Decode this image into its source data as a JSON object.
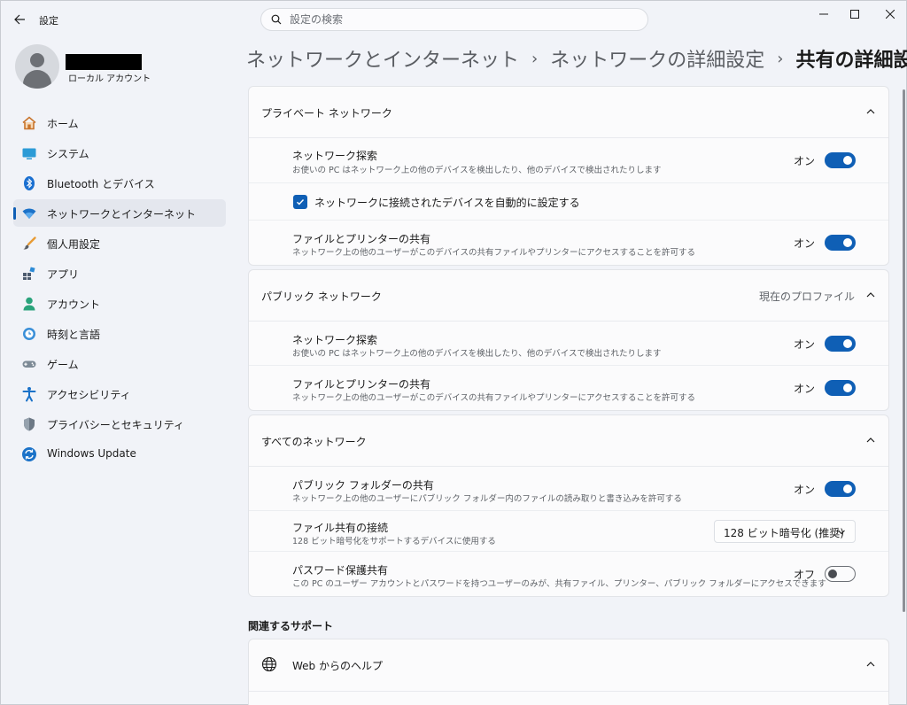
{
  "window": {
    "title": "設定",
    "search_placeholder": "設定の検索"
  },
  "profile": {
    "account_type": "ローカル アカウント"
  },
  "sidebar": {
    "items": [
      {
        "label": "ホーム",
        "icon": "home-icon"
      },
      {
        "label": "システム",
        "icon": "system-icon"
      },
      {
        "label": "Bluetooth とデバイス",
        "icon": "bluetooth-icon"
      },
      {
        "label": "ネットワークとインターネット",
        "icon": "network-icon",
        "selected": true
      },
      {
        "label": "個人用設定",
        "icon": "brush-icon"
      },
      {
        "label": "アプリ",
        "icon": "apps-icon"
      },
      {
        "label": "アカウント",
        "icon": "account-icon"
      },
      {
        "label": "時刻と言語",
        "icon": "time-language-icon"
      },
      {
        "label": "ゲーム",
        "icon": "gamepad-icon"
      },
      {
        "label": "アクセシビリティ",
        "icon": "accessibility-icon"
      },
      {
        "label": "プライバシーとセキュリティ",
        "icon": "shield-icon"
      },
      {
        "label": "Windows Update",
        "icon": "update-icon"
      }
    ]
  },
  "breadcrumb": {
    "level1": "ネットワークとインターネット",
    "level2": "ネットワークの詳細設定",
    "current": "共有の詳細設定",
    "separator": "›"
  },
  "private_network": {
    "title": "プライベート ネットワーク",
    "discovery": {
      "title": "ネットワーク探索",
      "desc": "お使いの PC はネットワーク上の他のデバイスを検出したり、他のデバイスで検出されたりします",
      "state": "オン"
    },
    "auto_setup": {
      "label": "ネットワークに接続されたデバイスを自動的に設定する",
      "checked": true
    },
    "file_printer": {
      "title": "ファイルとプリンターの共有",
      "desc": "ネットワーク上の他のユーザーがこのデバイスの共有ファイルやプリンターにアクセスすることを許可する",
      "state": "オン"
    }
  },
  "public_network": {
    "title": "パブリック ネットワーク",
    "note": "現在のプロファイル",
    "discovery": {
      "title": "ネットワーク探索",
      "desc": "お使いの PC はネットワーク上の他のデバイスを検出したり、他のデバイスで検出されたりします",
      "state": "オン"
    },
    "file_printer": {
      "title": "ファイルとプリンターの共有",
      "desc": "ネットワーク上の他のユーザーがこのデバイスの共有ファイルやプリンターにアクセスすることを許可する",
      "state": "オン"
    }
  },
  "all_networks": {
    "title": "すべてのネットワーク",
    "public_folder": {
      "title": "パブリック フォルダーの共有",
      "desc": "ネットワーク上の他のユーザーにパブリック フォルダー内のファイルの読み取りと書き込みを許可する",
      "state": "オン"
    },
    "file_sharing_conn": {
      "title": "ファイル共有の接続",
      "desc": "128 ビット暗号化をサポートするデバイスに使用する",
      "value": "128 ビット暗号化 (推奨)"
    },
    "password_sharing": {
      "title": "パスワード保護共有",
      "desc": "この PC のユーザー アカウントとパスワードを持つユーザーのみが、共有ファイル、プリンター、パブリック フォルダーにアクセスできます",
      "state": "オフ"
    }
  },
  "related_support": {
    "heading": "関連するサポート",
    "web_help": "Web からのヘルプ"
  },
  "colors": {
    "accent": "#0f5fb5",
    "background": "#f1f3f8",
    "card": "#fbfbfc"
  }
}
